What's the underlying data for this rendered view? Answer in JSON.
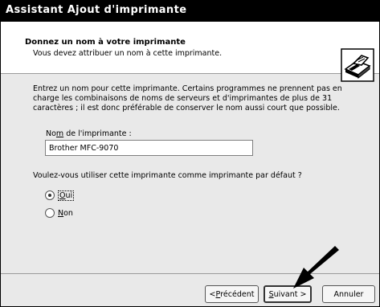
{
  "window": {
    "title": "Assistant Ajout d'imprimante"
  },
  "header": {
    "title": "Donnez un nom à votre imprimante",
    "subtitle": "Vous devez attribuer un nom à cette imprimante.",
    "icon": "printer-icon"
  },
  "body": {
    "description": "Entrez un nom pour cette imprimante. Certains programmes ne prennent pas en charge les combinaisons de noms de serveurs et d'imprimantes de plus de 31 caractères ; il est donc préférable de conserver le nom aussi court que possible.",
    "name_label_pre": "No",
    "name_label_mnemonic": "m",
    "name_label_post": " de l'imprimante :",
    "name_value": "Brother MFC-9070",
    "default_question": "Voulez-vous utiliser cette imprimante comme imprimante par défaut ?",
    "options": [
      {
        "mnemonic": "O",
        "rest": "ui",
        "selected": true
      },
      {
        "mnemonic": "N",
        "rest": "on",
        "selected": false
      }
    ]
  },
  "buttons": {
    "back_prefix": "< ",
    "back_mnemonic": "P",
    "back_rest": "récédent",
    "next_mnemonic": "S",
    "next_rest": "uivant >",
    "cancel": "Annuler"
  },
  "annotation": {
    "arrow_icon": "arrow-pointer-icon",
    "color": "#000000"
  }
}
